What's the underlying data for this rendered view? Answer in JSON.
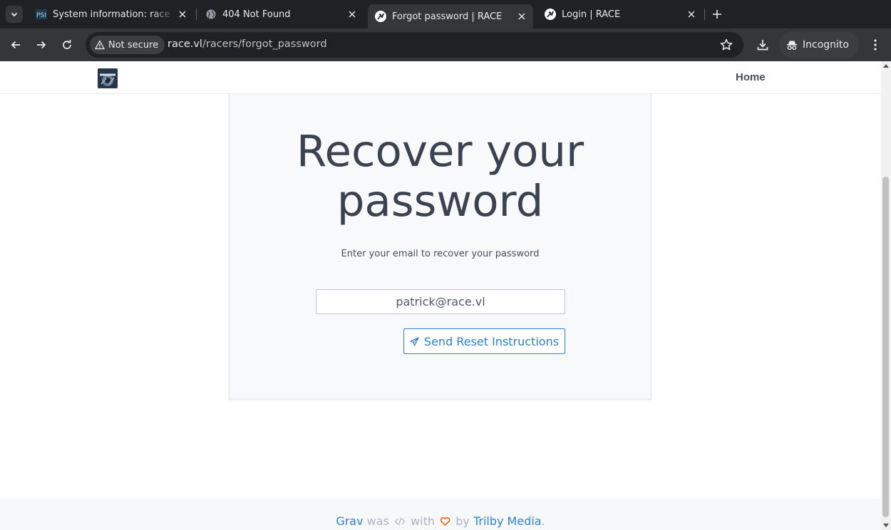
{
  "browser": {
    "tabs": [
      {
        "title": "System information: race",
        "favicon": "psi-icon",
        "active": false
      },
      {
        "title": "404 Not Found",
        "favicon": "globe-icon",
        "active": false
      },
      {
        "title": "Forgot password | RACE",
        "favicon": "race-icon",
        "active": true
      },
      {
        "title": "Login | RACE",
        "favicon": "race-icon",
        "active": false
      }
    ],
    "security_chip": "Not secure",
    "url_host": "race.vl",
    "url_path": "/racers/forgot_password",
    "profile_label": "Incognito"
  },
  "site": {
    "nav_home": "Home"
  },
  "form": {
    "title": "Recover your password",
    "subtitle": "Enter your email to recover your password",
    "email_value": "patrick@race.vl",
    "submit_label": "Send Reset Instructions"
  },
  "footer": {
    "grav": "Grav",
    "was": "was",
    "with": "with",
    "by": "by",
    "trilby": "Trilby Media",
    "period": "."
  },
  "colors": {
    "accent": "#2f80d1",
    "heading": "#3b4351",
    "card_bg": "#f8f9fa",
    "heart": "#e85600"
  }
}
